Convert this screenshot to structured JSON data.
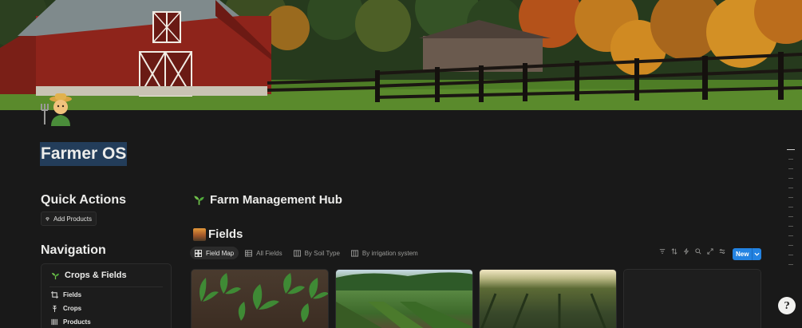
{
  "page": {
    "title": "Farmer OS",
    "icon": "farmer-emoji"
  },
  "quick_actions": {
    "title": "Quick Actions",
    "buttons": [
      {
        "label": "Add Products",
        "icon": "gem-icon"
      }
    ]
  },
  "navigation": {
    "title": "Navigation",
    "section": {
      "label": "Crops & Fields",
      "icon": "seedling-icon"
    },
    "items": [
      {
        "label": "Fields",
        "icon": "crop-icon"
      },
      {
        "label": "Crops",
        "icon": "wheat-icon"
      },
      {
        "label": "Products",
        "icon": "barcode-icon"
      }
    ]
  },
  "main": {
    "hub_title": "Farm Management Hub",
    "hub_icon": "seedling-icon",
    "fields_title": "Fields",
    "fields_icon": "fields-emoji",
    "tabs": [
      {
        "label": "Field Map",
        "icon": "gallery-icon",
        "active": true
      },
      {
        "label": "All Fields",
        "icon": "table-icon",
        "active": false
      },
      {
        "label": "By Soil Type",
        "icon": "board-icon",
        "active": false
      },
      {
        "label": "By irrigation system",
        "icon": "board-icon",
        "active": false
      }
    ],
    "toolbar_icons": [
      "filter-icon",
      "sort-icon",
      "automation-icon",
      "search-icon",
      "expand-icon",
      "settings-icon"
    ],
    "new_button": {
      "label": "New"
    }
  },
  "colors": {
    "background": "#191919",
    "accent": "#2383e2",
    "title_highlight": "#233d5a"
  }
}
